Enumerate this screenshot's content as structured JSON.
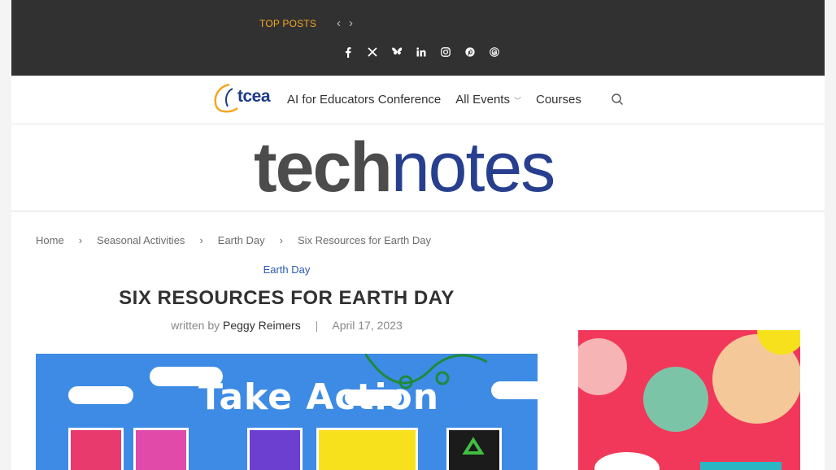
{
  "topbar": {
    "top_posts_label": "TOP POSTS",
    "prev_label": "‹",
    "next_label": "›",
    "socials": [
      "facebook-icon",
      "x-icon",
      "bluesky-icon",
      "linkedin-icon",
      "instagram-icon",
      "pinterest-icon",
      "threads-icon"
    ]
  },
  "header": {
    "logo_text": "tcea",
    "nav": [
      {
        "label": "AI for Educators Conference"
      },
      {
        "label": "All Events",
        "has_submenu": true
      },
      {
        "label": "Courses"
      }
    ]
  },
  "masthead": {
    "brand_part1": "tech",
    "brand_part2": "notes"
  },
  "breadcrumb": [
    "Home",
    "Seasonal Activities",
    "Earth Day",
    "Six Resources for Earth Day"
  ],
  "article": {
    "category": "Earth Day",
    "title": "SIX RESOURCES FOR EARTH DAY",
    "byline_prefix": "written by",
    "author": "Peggy Reimers",
    "date": "April 17, 2023",
    "feature_image_text": "Take Action"
  },
  "colors": {
    "accent": "#f5a623",
    "link_blue": "#2c5bb0",
    "brand_blue": "#273f8e",
    "topbar_bg": "#313131"
  }
}
